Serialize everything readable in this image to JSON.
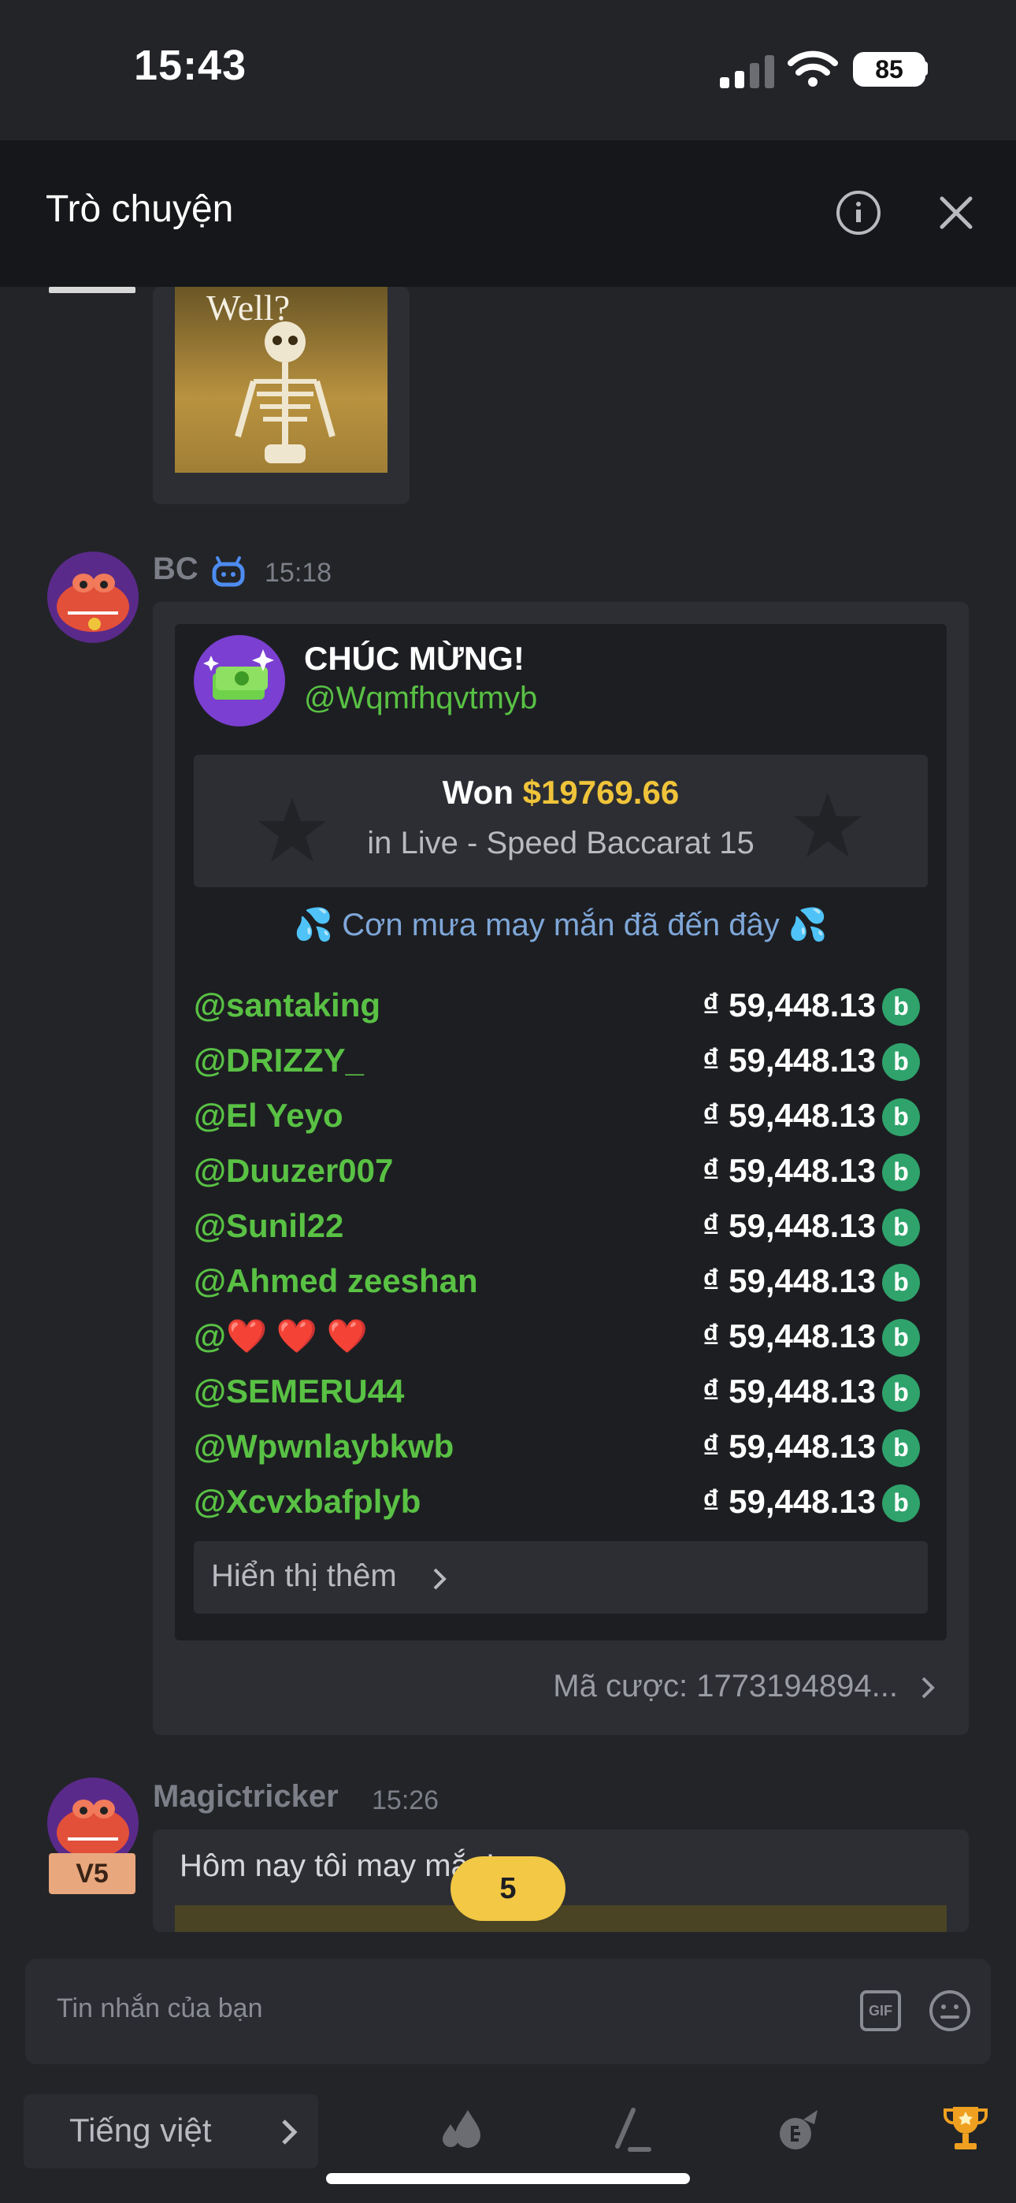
{
  "status_bar": {
    "time": "15:43",
    "battery": "85"
  },
  "header": {
    "title": "Trò chuyện"
  },
  "gif_caption": "Well?",
  "message_bc": {
    "sender": "BC",
    "time": "15:18",
    "congrats_title": "CHÚC MỪNG!",
    "congrats_user": "@Wqmfhqvtmyb",
    "won_label": "Won",
    "won_amount": "$19769.66",
    "game": "in Live - Speed Baccarat 15",
    "rain_text": "💦 Cơn mưa may mắn đã đến đây 💦",
    "recipients": [
      {
        "name": "@santaking",
        "amount": "₫ 59,448.13"
      },
      {
        "name": "@DRIZZY_",
        "amount": "₫ 59,448.13"
      },
      {
        "name": "@El Yeyo",
        "amount": "₫ 59,448.13"
      },
      {
        "name": "@Duuzer007",
        "amount": "₫ 59,448.13"
      },
      {
        "name": "@Sunil22",
        "amount": "₫ 59,448.13"
      },
      {
        "name": "@Ahmed zeeshan",
        "amount": "₫ 59,448.13"
      },
      {
        "name": "@❤️ ❤️ ❤️",
        "amount": "₫ 59,448.13"
      },
      {
        "name": "@SEMERU44",
        "amount": "₫ 59,448.13"
      },
      {
        "name": "@Wpwnlaybkwb",
        "amount": "₫ 59,448.13"
      },
      {
        "name": "@Xcvxbafplyb",
        "amount": "₫ 59,448.13"
      }
    ],
    "show_more": "Hiển thị thêm",
    "bet_code": "Mã cược: 1773194894..."
  },
  "message_magic": {
    "sender": "Magictricker",
    "time": "15:26",
    "vip": "V5",
    "text": "Hôm nay tôi may mắn!"
  },
  "unread_badge": "5",
  "input": {
    "placeholder": "Tin nhắn của bạn",
    "gif_label": "GIF"
  },
  "bottom_bar": {
    "language": "Tiếng việt"
  },
  "colors": {
    "accent_green": "#59c144",
    "gold": "#f0c43a",
    "coin": "#2fa36b"
  }
}
